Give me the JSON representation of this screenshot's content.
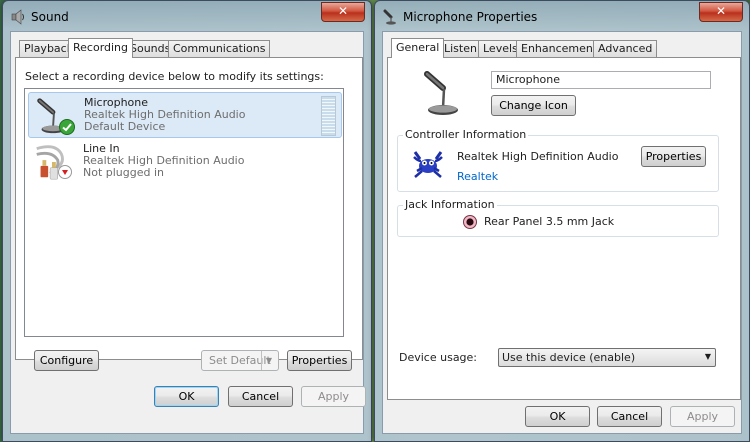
{
  "sound_window": {
    "title": "Sound",
    "tabs": [
      "Playback",
      "Recording",
      "Sounds",
      "Communications"
    ],
    "active_tab": "Recording",
    "instruction": "Select a recording device below to modify its settings:",
    "devices": [
      {
        "name": "Microphone",
        "driver": "Realtek High Definition Audio",
        "status": "Default Device",
        "icon": "microphone-icon",
        "badge": "green-check-icon"
      },
      {
        "name": "Line In",
        "driver": "Realtek High Definition Audio",
        "status": "Not plugged in",
        "icon": "line-in-cable-icon",
        "badge": "red-down-arrow-icon"
      }
    ],
    "configure_label": "Configure",
    "set_default_label": "Set Default",
    "properties_label": "Properties",
    "ok_label": "OK",
    "cancel_label": "Cancel",
    "apply_label": "Apply"
  },
  "mic_window": {
    "title": "Microphone Properties",
    "tabs": [
      "General",
      "Listen",
      "Levels",
      "Enhancements",
      "Advanced"
    ],
    "active_tab": "General",
    "device_name_value": "Microphone",
    "change_icon_label": "Change Icon",
    "controller_group_label": "Controller Information",
    "controller_name": "Realtek High Definition Audio",
    "controller_vendor": "Realtek",
    "controller_properties_label": "Properties",
    "jack_group_label": "Jack Information",
    "jack_value": "Rear Panel 3.5 mm Jack",
    "device_usage_label": "Device usage:",
    "device_usage_value": "Use this device (enable)",
    "ok_label": "OK",
    "cancel_label": "Cancel",
    "apply_label": "Apply"
  },
  "colors": {
    "selection": "#dce9f7",
    "link": "#0066cc",
    "close_button": "#c7402b"
  }
}
